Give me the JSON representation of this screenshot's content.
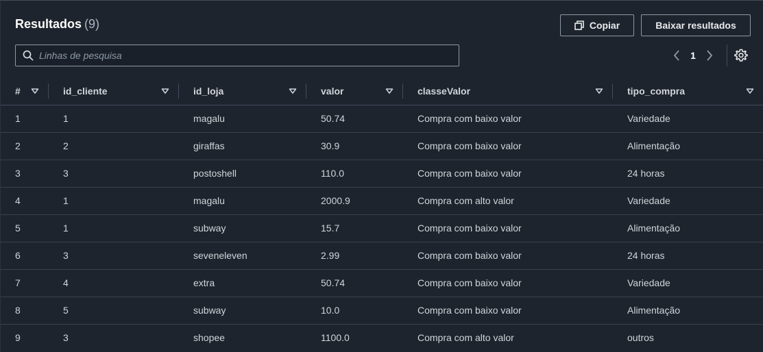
{
  "header": {
    "title": "Resultados",
    "count": "(9)",
    "copy_label": "Copiar",
    "download_label": "Baixar resultados",
    "copy_icon": "copy-icon",
    "search_icon": "search-icon",
    "settings_icon": "gear-icon"
  },
  "search": {
    "placeholder": "Linhas de pesquisa",
    "value": ""
  },
  "pagination": {
    "current_page": "1",
    "prev_icon": "chevron-left-icon",
    "next_icon": "chevron-right-icon"
  },
  "table": {
    "columns": [
      "#",
      "id_cliente",
      "id_loja",
      "valor",
      "classeValor",
      "tipo_compra"
    ],
    "rows": [
      [
        "1",
        "1",
        "magalu",
        "50.74",
        "Compra com baixo valor",
        "Variedade"
      ],
      [
        "2",
        "2",
        "giraffas",
        "30.9",
        "Compra com baixo valor",
        "Alimentação"
      ],
      [
        "3",
        "3",
        "postoshell",
        "110.0",
        "Compra com baixo valor",
        "24 horas"
      ],
      [
        "4",
        "1",
        "magalu",
        "2000.9",
        "Compra com alto valor",
        "Variedade"
      ],
      [
        "5",
        "1",
        "subway",
        "15.7",
        "Compra com baixo valor",
        "Alimentação"
      ],
      [
        "6",
        "3",
        "seveneleven",
        "2.99",
        "Compra com baixo valor",
        "24 horas"
      ],
      [
        "7",
        "4",
        "extra",
        "50.74",
        "Compra com baixo valor",
        "Variedade"
      ],
      [
        "8",
        "5",
        "subway",
        "10.0",
        "Compra com baixo valor",
        "Alimentação"
      ],
      [
        "9",
        "3",
        "shopee",
        "1100.0",
        "Compra com alto valor",
        "outros"
      ]
    ]
  },
  "colors": {
    "background": "#1e242d",
    "border": "#414d5c",
    "text": "#d1d5db",
    "heading": "#fbfbfb"
  }
}
